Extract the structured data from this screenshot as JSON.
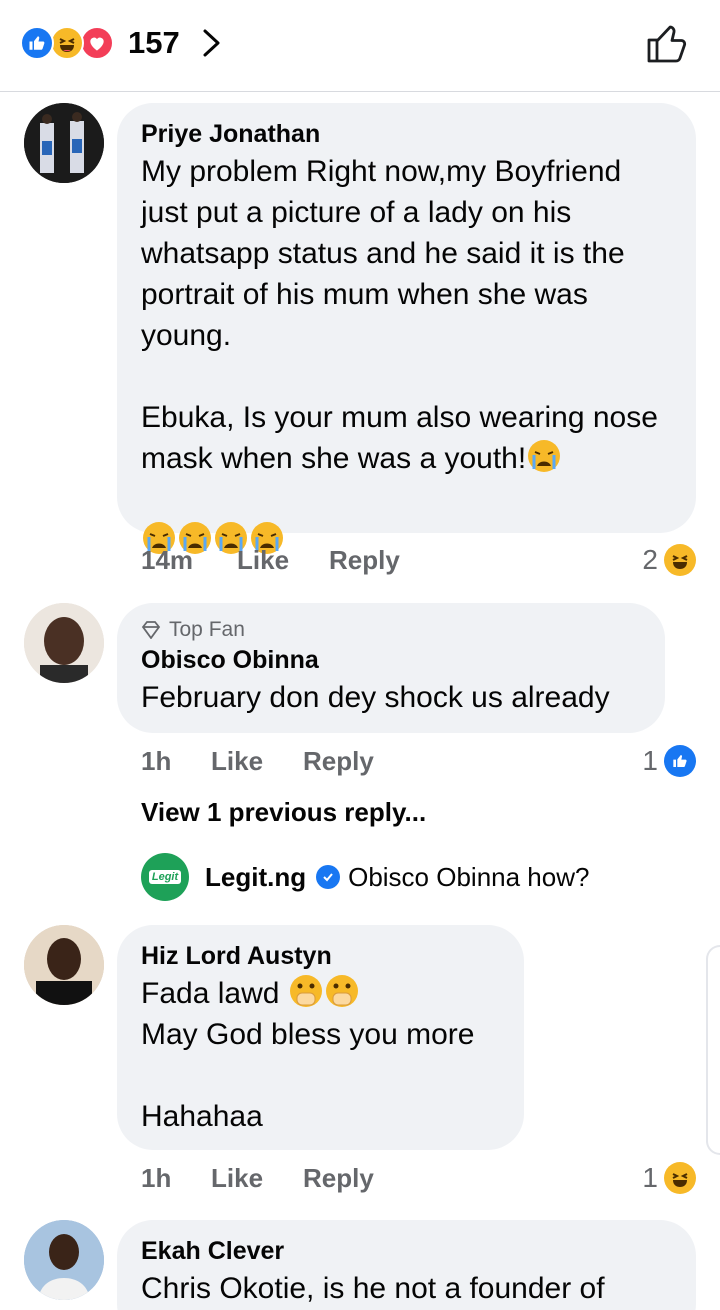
{
  "header": {
    "reaction_count": "157",
    "reactions": [
      "like-icon",
      "haha-icon",
      "love-icon"
    ]
  },
  "comments": [
    {
      "name": "Priye Jonathan",
      "text": "My problem Right now,my Boyfriend just put a picture of a lady on his whatsapp status and he said it is the portrait of his mum when she was young.\n\nEbuka, Is your mum also wearing nose mask when she was a youth!",
      "time": "14m",
      "like": "Like",
      "reply": "Reply",
      "reaction_count": "2",
      "reaction": "haha-icon"
    },
    {
      "badge": "Top Fan",
      "name": "Obisco Obinna",
      "text": "February don dey shock us already",
      "time": "1h",
      "like": "Like",
      "reply": "Reply",
      "reaction_count": "1",
      "reaction": "like-icon"
    },
    {
      "name": "Hiz Lord Austyn",
      "text_line1": "Fada lawd",
      "text_rest": "May God bless you more\n\nHahahaa",
      "time": "1h",
      "like": "Like",
      "reply": "Reply",
      "reaction_count": "1",
      "reaction": "haha-icon"
    },
    {
      "name": "Ekah Clever",
      "text": "Chris Okotie, is he not a founder of"
    }
  ],
  "replies": {
    "view_previous": "View 1 previous reply...",
    "author": "Legit.ng",
    "logo_text": "Legit",
    "text": "Obisco Obinna how?"
  },
  "colors": {
    "like_blue": "#1877f2",
    "haha_yellow": "#f7b928",
    "love_red": "#f33e58",
    "bubble_gray": "#f0f2f5",
    "meta_gray": "#65676b",
    "legit_green": "#1ea158"
  }
}
